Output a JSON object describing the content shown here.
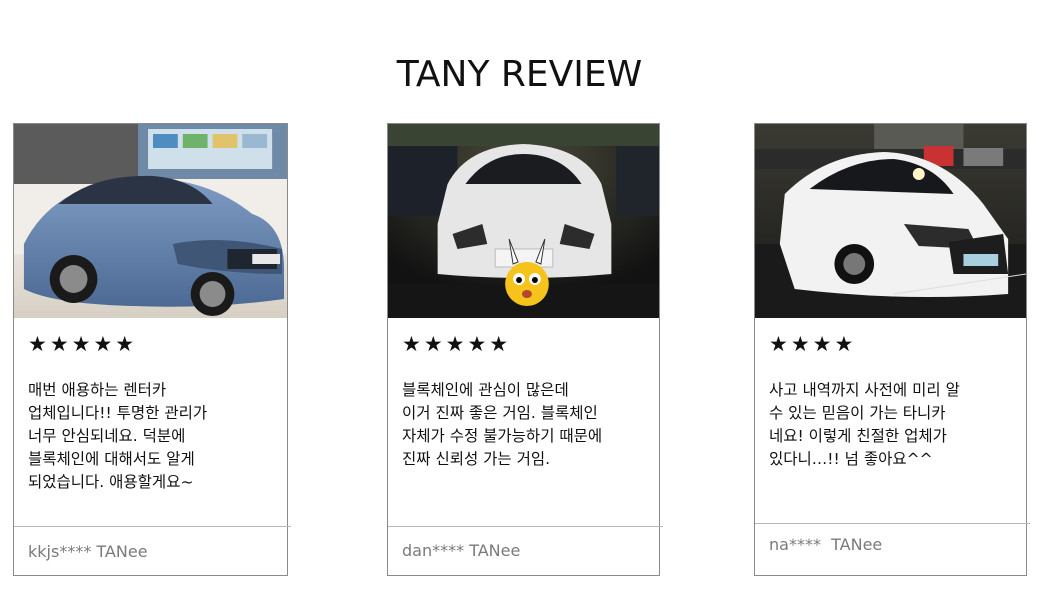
{
  "header": {
    "title": "TANY REVIEW"
  },
  "reviews": [
    {
      "photo": "blue-sedan-photo",
      "stars": "★★★★★",
      "rating": 5,
      "text": "매번 애용하는 렌터카\n업체입니다!! 투명한 관리가\n너무 안심되네요. 덕분에\n블록체인에 대해서도 알게\n되었습니다. 애용할게요~",
      "reviewer": "kkjs**** TANee"
    },
    {
      "photo": "white-sedan-night-photo",
      "stars": "★★★★★",
      "rating": 5,
      "text": "블록체인에 관심이 많은데\n이거 진짜 좋은 거임. 블록체인\n자체가 수정 불가능하기 때문에\n진짜 신뢰성 가는 거임.",
      "reviewer": "dan**** TANee"
    },
    {
      "photo": "white-coupe-night-photo",
      "stars": "★★★★",
      "rating": 4,
      "text": "사고 내역까지 사전에 미리 알\n수 있는 믿음이 가는 타니카\n네요! 이렇게 친절한 업체가\n있다니…!! 넘 좋아요^^",
      "reviewer": "na****  TANee"
    }
  ],
  "colors": {
    "border": "#8a8a8a",
    "divider": "#b9b9b9",
    "reviewer_text": "#7a7a7a"
  }
}
